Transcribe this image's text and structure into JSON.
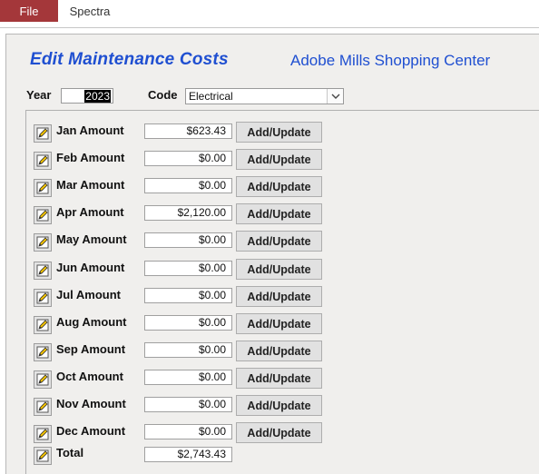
{
  "ribbon": {
    "file_tab": "File",
    "spectra_tab": "Spectra"
  },
  "form": {
    "title": "Edit Maintenance Costs",
    "property": "Adobe Mills Shopping Center",
    "year_label": "Year",
    "year_value": "2023",
    "code_label": "Code",
    "code_value": "Electrical"
  },
  "button_label": "Add/Update",
  "months": [
    {
      "label": "Jan Amount",
      "amount": "$623.43"
    },
    {
      "label": "Feb Amount",
      "amount": "$0.00"
    },
    {
      "label": "Mar Amount",
      "amount": "$0.00"
    },
    {
      "label": "Apr Amount",
      "amount": "$2,120.00"
    },
    {
      "label": "May Amount",
      "amount": "$0.00"
    },
    {
      "label": "Jun Amount",
      "amount": "$0.00"
    },
    {
      "label": "Jul Amount",
      "amount": "$0.00"
    },
    {
      "label": "Aug Amount",
      "amount": "$0.00"
    },
    {
      "label": "Sep Amount",
      "amount": "$0.00"
    },
    {
      "label": "Oct Amount",
      "amount": "$0.00"
    },
    {
      "label": "Nov Amount",
      "amount": "$0.00"
    },
    {
      "label": "Dec Amount",
      "amount": "$0.00"
    }
  ],
  "total": {
    "label": "Total",
    "amount": "$2,743.43"
  },
  "colors": {
    "file_tab": "#a4373a",
    "title": "#1f4fd1",
    "form_bg": "#f0efed"
  }
}
